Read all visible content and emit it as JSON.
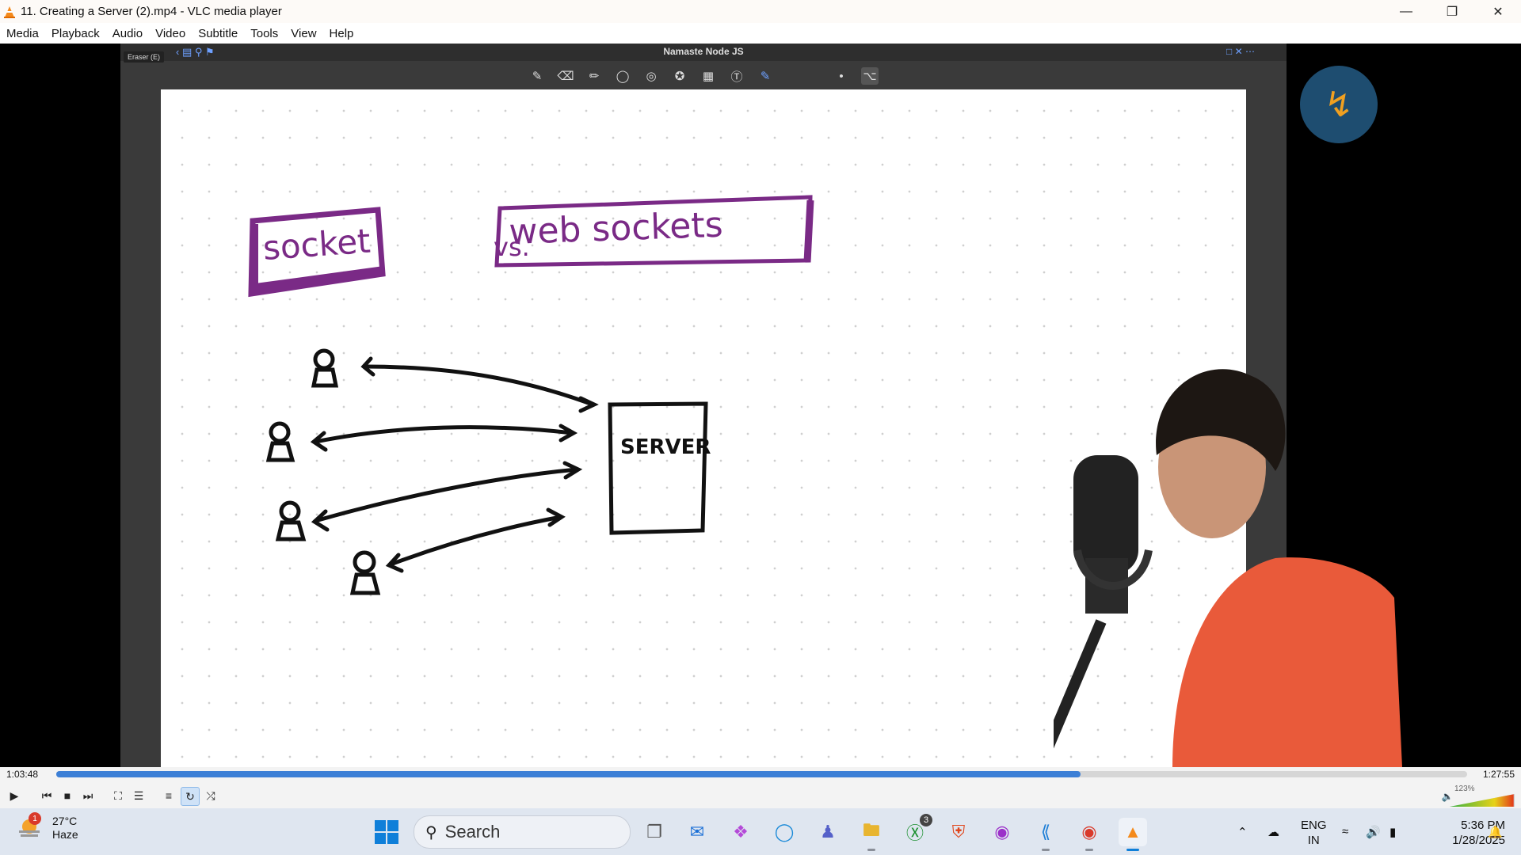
{
  "window": {
    "title": "11. Creating a Server (2).mp4 - VLC media player"
  },
  "menu": [
    "Media",
    "Playback",
    "Audio",
    "Video",
    "Subtitle",
    "Tools",
    "View",
    "Help"
  ],
  "board": {
    "title": "Namaste Node JS",
    "tooltip": "Eraser (E)",
    "box1": "socket",
    "vs": "vs.",
    "box2": "web sockets",
    "server": "SERVER"
  },
  "player": {
    "elapsed": "1:03:48",
    "total": "1:27:55",
    "progress": 0.726,
    "volume_percent": "123%",
    "volume_level": 1.23
  },
  "taskbar": {
    "weather_temp": "27°C",
    "weather_desc": "Haze",
    "weather_badge": "1",
    "search_label": "Search",
    "xbox_badge": "3",
    "lang_line1": "ENG",
    "lang_line2": "IN",
    "time": "5:36 PM",
    "date": "1/28/2025"
  },
  "colors": {
    "accent": "#3c7fd6",
    "box_purple": "#7a2a86",
    "shirt": "#e95a3a"
  }
}
